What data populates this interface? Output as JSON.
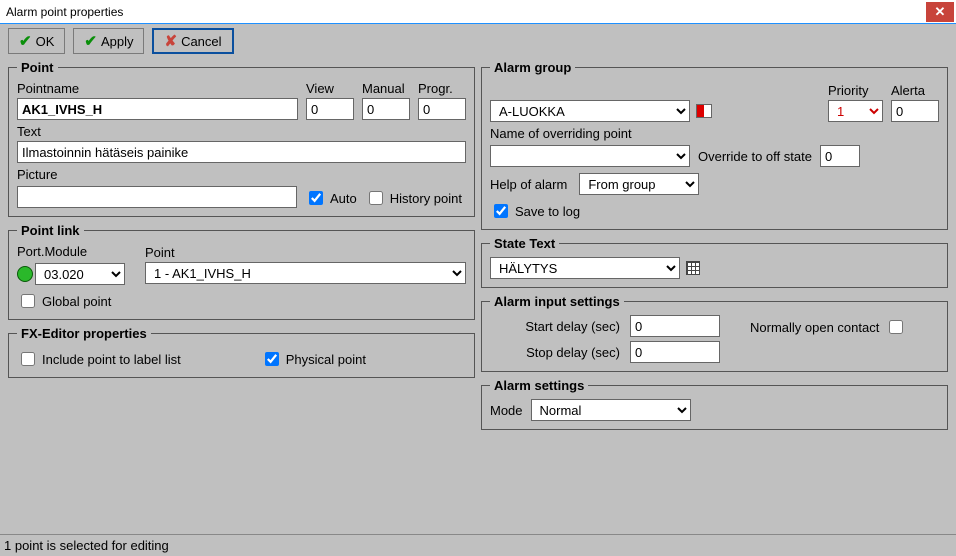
{
  "window": {
    "title": "Alarm point properties"
  },
  "toolbar": {
    "ok": "OK",
    "apply": "Apply",
    "cancel": "Cancel"
  },
  "point": {
    "legend": "Point",
    "pointname_label": "Pointname",
    "pointname": "AK1_IVHS_H",
    "view_label": "View",
    "view": "0",
    "manual_label": "Manual",
    "manual": "0",
    "progr_label": "Progr.",
    "progr": "0",
    "text_label": "Text",
    "text": "Ilmastoinnin hätäseis painike",
    "picture_label": "Picture",
    "picture": "",
    "auto_label": "Auto",
    "auto_checked": true,
    "history_label": "History point",
    "history_checked": false
  },
  "pointlink": {
    "legend": "Point link",
    "portmodule_label": "Port.Module",
    "portmodule": "03.020",
    "point_label": "Point",
    "point": "1 - AK1_IVHS_H",
    "global_label": "Global point",
    "global_checked": false
  },
  "fx": {
    "legend": "FX-Editor properties",
    "include_label": "Include point to label list",
    "include_checked": false,
    "physical_label": "Physical point",
    "physical_checked": true
  },
  "alarmgroup": {
    "legend": "Alarm group",
    "group": "A-LUOKKA",
    "priority_label": "Priority",
    "priority": "1",
    "alerta_label": "Alerta",
    "alerta": "0",
    "override_name_label": "Name of overriding point",
    "override_name": "",
    "override_state_label": "Override to off state",
    "override_state": "0",
    "help_label": "Help of alarm",
    "help": "From group",
    "save_log_label": "Save to log",
    "save_log_checked": true
  },
  "statetext": {
    "legend": "State Text",
    "value": "HÄLYTYS"
  },
  "alarminput": {
    "legend": "Alarm input settings",
    "start_label": "Start delay (sec)",
    "start": "0",
    "stop_label": "Stop delay (sec)",
    "stop": "0",
    "noc_label": "Normally open contact",
    "noc_checked": false
  },
  "alarmsettings": {
    "legend": "Alarm settings",
    "mode_label": "Mode",
    "mode": "Normal"
  },
  "status": {
    "text": "1 point is selected for editing"
  }
}
